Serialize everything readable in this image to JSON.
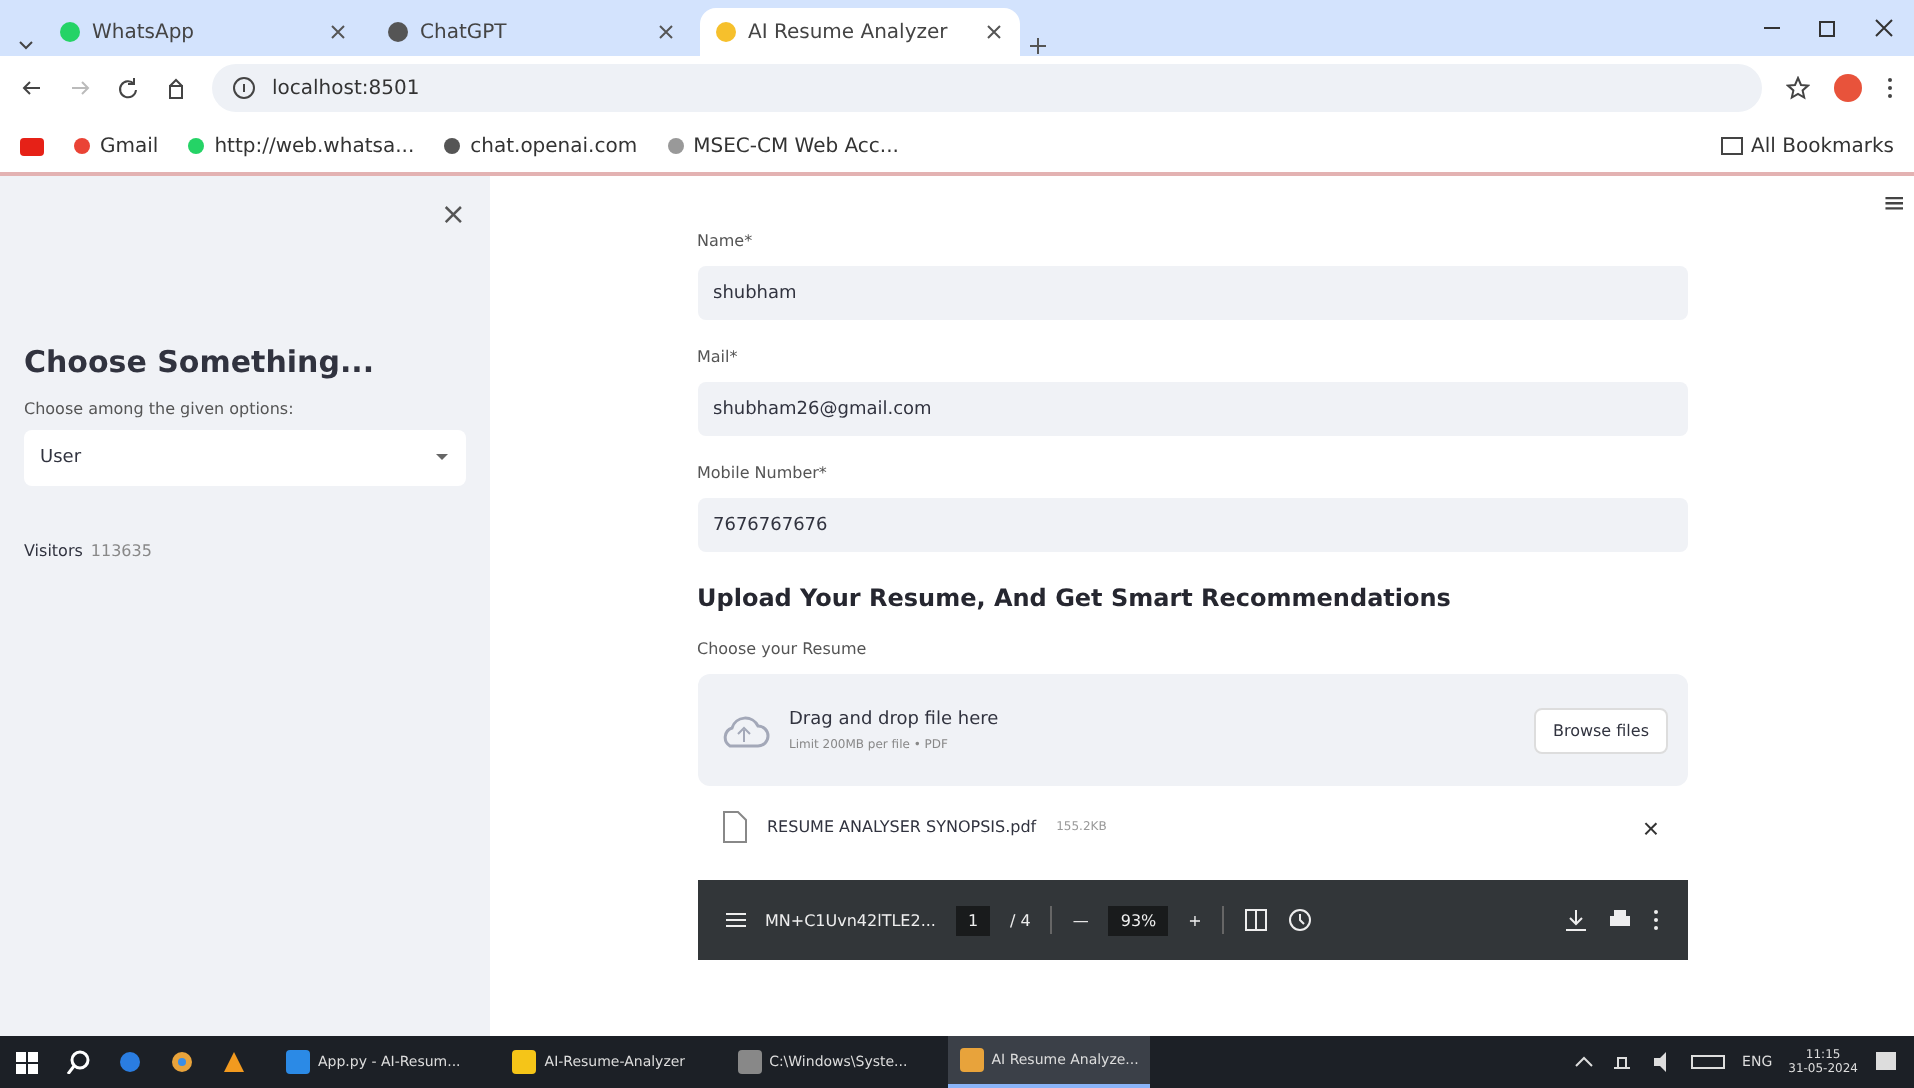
{
  "browser": {
    "tabs": [
      {
        "label": "WhatsApp",
        "selected": false
      },
      {
        "label": "ChatGPT",
        "selected": false
      },
      {
        "label": "AI Resume Analyzer",
        "selected": true
      }
    ],
    "address": "localhost:8501",
    "bookmarks": [
      "Gmail",
      "http://web.whatsa...",
      "chat.openai.com",
      "MSEC-CM Web Acc..."
    ],
    "all_bookmarks": "All Bookmarks"
  },
  "sidebar": {
    "close": "×",
    "title": "Choose Something...",
    "select_label": "Choose among the given options:",
    "select_value": "User",
    "visitors_label": "Visitors",
    "visitors_count": "113635"
  },
  "menu_icon": "≡",
  "form": {
    "fields": [
      {
        "label": "Name*",
        "value": "shubham"
      },
      {
        "label": "Mail*",
        "value": "shubham26@gmail.com"
      },
      {
        "label": "Mobile Number*",
        "value": "7676767676"
      }
    ],
    "heading": "Upload Your Resume, And Get Smart Recommendations",
    "upload_label": "Choose your Resume",
    "dropzone": {
      "title": "Drag and drop file here",
      "hint": "Limit 200MB per file • PDF",
      "button": "Browse files"
    },
    "file": {
      "name": "RESUME ANALYSER SYNOPSIS.pdf",
      "size": "155.2KB",
      "remove": "×"
    },
    "pdf_toolbar": {
      "title": "MN+C1Uvn42lTLE2...",
      "page": "1",
      "pages": "/ 4",
      "zoom": "93%",
      "minus": "—",
      "plus": "+"
    }
  },
  "taskbar": {
    "apps": [
      {
        "label": "App.py - AI-Resum...",
        "selected": false
      },
      {
        "label": "AI-Resume-Analyzer",
        "selected": false
      },
      {
        "label": "C:\\Windows\\Syste...",
        "selected": false
      },
      {
        "label": "AI Resume Analyze...",
        "selected": true
      }
    ],
    "lang": "ENG",
    "time": "11:15",
    "date": "31-05-2024"
  }
}
